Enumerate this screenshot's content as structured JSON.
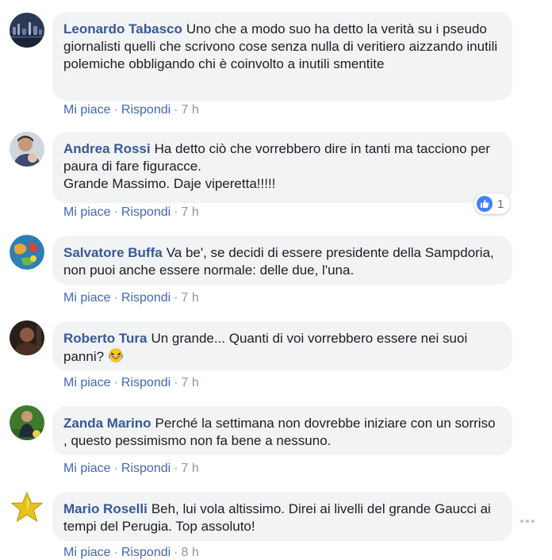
{
  "comments": [
    {
      "author": "Leonardo Tabasco",
      "text": "Uno che a modo suo ha detto la verità su i pseudo giornalisti quelli che scrivono cose senza nulla di veritiero aizzando inutili polemiche obbligando chi è coinvolto a inutili smentite",
      "like": "Mi piace",
      "reply": "Rispondi",
      "time": "7 h",
      "avatar": "city-night-photo"
    },
    {
      "author": "Andrea Rossi",
      "text": "Ha detto ciò che vorrebbero dire in tanti ma tacciono per paura di fare figuracce.\nGrande Massimo. Daje viperetta!!!!!",
      "like": "Mi piace",
      "reply": "Rispondi",
      "time": "7 h",
      "avatar": "person-with-child-photo",
      "reaction_count": "1"
    },
    {
      "author": "Salvatore Buffa",
      "text": "Va be', se decidi di essere presidente della Sampdoria, non puoi anche essere normale: delle due, l'una.",
      "like": "Mi piace",
      "reply": "Rispondi",
      "time": "7 h",
      "avatar": "colorful-globe-photo"
    },
    {
      "author": "Roberto Tura",
      "text": "Un grande... Quanti di voi vorrebbero essere nei suoi panni?",
      "like": "Mi piace",
      "reply": "Rispondi",
      "time": "7 h",
      "avatar": "dark-portrait-photo",
      "emoji": "laughing-crying-emoji"
    },
    {
      "author": "Zanda Marino",
      "text": "Perché la settimana non dovrebbe iniziare con un sorriso , questo pessimismo non fa bene a nessuno.",
      "like": "Mi piace",
      "reply": "Rispondi",
      "time": "7 h",
      "avatar": "person-on-grass-photo"
    },
    {
      "author": "Mario Roselli",
      "text": "Beh, lui vola altissimo. Direi ai livelli del grande Gaucci ai tempi del Perugia. Top assoluto!",
      "like": "Mi piace",
      "reply": "Rispondi",
      "time": "8 h",
      "avatar": "gold-star-image"
    }
  ],
  "colors": {
    "author": "#385898",
    "link": "#4267b2",
    "bubble": "#f2f3f5",
    "meta": "#90949c",
    "like": "#4080ff"
  },
  "icons": {
    "reaction": "thumbs-up-icon",
    "more": "more-options-icon"
  }
}
